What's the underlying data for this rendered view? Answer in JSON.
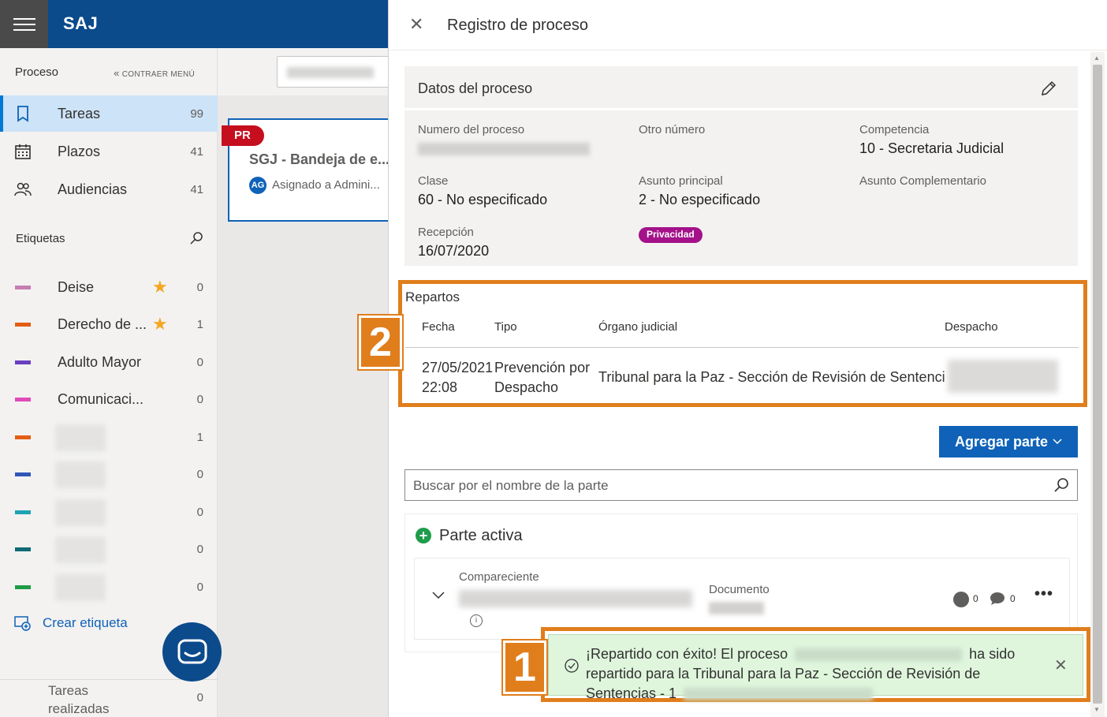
{
  "app": {
    "title": "SAJ"
  },
  "sidebar": {
    "section": "Proceso",
    "collapse": "CONTRAER MENÚ",
    "nav": [
      {
        "label": "Tareas",
        "count": "99"
      },
      {
        "label": "Plazos",
        "count": "41"
      },
      {
        "label": "Audiencias",
        "count": "41"
      }
    ],
    "tags_title": "Etiquetas",
    "tags": [
      {
        "label": "Deise",
        "count": "0",
        "color": "#c77db3",
        "starred": true
      },
      {
        "label": "Derecho de ...",
        "count": "1",
        "color": "#e35e14",
        "starred": true
      },
      {
        "label": "Adulto Mayor",
        "count": "0",
        "color": "#6a3fbf",
        "starred": false
      },
      {
        "label": "Comunicaci...",
        "count": "0",
        "color": "#e04cb7",
        "starred": false
      },
      {
        "label": "",
        "count": "1",
        "color": "#e35e14",
        "starred": false
      },
      {
        "label": "",
        "count": "0",
        "color": "#2f57b8",
        "starred": false
      },
      {
        "label": "",
        "count": "0",
        "color": "#1fa3b3",
        "starred": false
      },
      {
        "label": "",
        "count": "0",
        "color": "#0e6b75",
        "starred": false
      },
      {
        "label": "",
        "count": "0",
        "color": "#1f9c44",
        "starred": false
      }
    ],
    "create_tag": "Crear etiqueta",
    "done": {
      "label": "Tareas realizadas",
      "count": "0"
    }
  },
  "list": {
    "card": {
      "badge": "PR",
      "title": "SGJ - Bandeja de e...",
      "avatar": "AG",
      "subtitle": "Asignado a Admini..."
    }
  },
  "panel": {
    "title": "Registro de proceso",
    "datos": {
      "title": "Datos del proceso",
      "fields": {
        "numero_label": "Numero del proceso",
        "otro_label": "Otro número",
        "competencia_label": "Competencia",
        "competencia_value": "10 - Secretaria Judicial",
        "clase_label": "Clase",
        "clase_value": "60 - No especificado",
        "asunto_label": "Asunto principal",
        "asunto_value": "2 - No especificado",
        "complementario_label": "Asunto Complementario",
        "recepcion_label": "Recepción",
        "recepcion_value": "16/07/2020",
        "privacidad": "Privacidad"
      }
    },
    "repartos": {
      "title": "Repartos",
      "headers": [
        "Fecha",
        "Tipo",
        "Órgano judicial",
        "Despacho"
      ],
      "row": {
        "fecha_1": "27/05/2021",
        "fecha_2": "22:08",
        "tipo_1": "Prevención por",
        "tipo_2": "Despacho",
        "organo": "Tribunal para la Paz - Sección de Revisión de Sentencias"
      }
    },
    "add_part": "Agregar parte",
    "search_placeholder": "Buscar por el nombre de la parte",
    "active": {
      "title": "Parte activa",
      "compareciente_label": "Compareciente",
      "documento_label": "Documento",
      "persons_count": "0",
      "comments_count": "0"
    },
    "toast": {
      "line1_a": "¡Repartido con éxito! El proceso",
      "line1_b": "ha sido",
      "line2": "repartido para la Tribunal para la Paz - Sección de Revisión de",
      "line3": "Sentencias - 1"
    }
  },
  "callouts": {
    "one": "1",
    "two": "2"
  },
  "colors": {
    "brand": "#0b4a8b",
    "accent": "#0f62b8",
    "highlight": "#e07e1c",
    "success_bg": "#dff6dd"
  }
}
